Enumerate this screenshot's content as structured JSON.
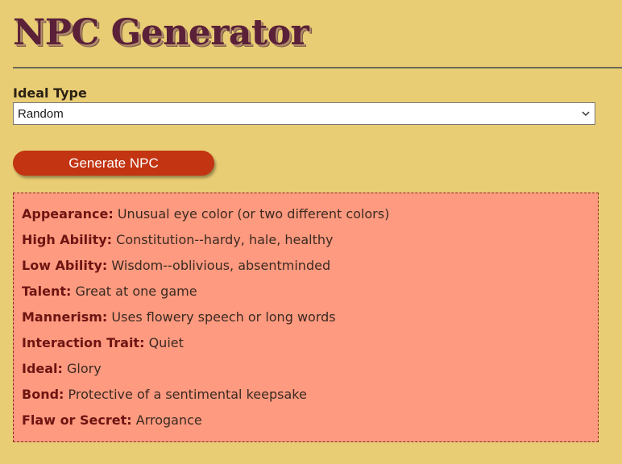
{
  "header": {
    "title": "NPC Generator"
  },
  "form": {
    "ideal_type_label": "Ideal Type",
    "ideal_type_selected": "Random",
    "generate_button_label": "Generate NPC"
  },
  "result": {
    "traits": [
      {
        "label": "Appearance:",
        "value": "Unusual eye color (or two different colors)"
      },
      {
        "label": "High Ability:",
        "value": "Constitution--hardy, hale, healthy"
      },
      {
        "label": "Low Ability:",
        "value": "Wisdom--oblivious, absentminded"
      },
      {
        "label": "Talent:",
        "value": "Great at one game"
      },
      {
        "label": "Mannerism:",
        "value": "Uses flowery speech or long words"
      },
      {
        "label": "Interaction Trait:",
        "value": "Quiet"
      },
      {
        "label": "Ideal:",
        "value": "Glory"
      },
      {
        "label": "Bond:",
        "value": "Protective of a sentimental keepsake"
      },
      {
        "label": "Flaw or Secret:",
        "value": "Arrogance"
      }
    ]
  },
  "colors": {
    "background": "#e9cd74",
    "title": "#5a2138",
    "button": "#c23412",
    "panel": "#fe9a7f",
    "trait_label": "#6e1412"
  },
  "icons": {
    "select_arrow": "chevron-down-icon"
  }
}
